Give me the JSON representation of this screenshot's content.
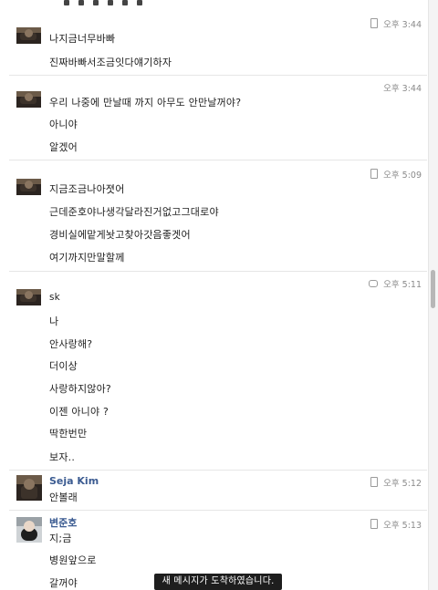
{
  "groups": [
    {
      "time": "오후 3:44",
      "messages": [
        "나지금너무바빠",
        "진짜바빠서조금잇다얘기하자"
      ]
    },
    {
      "time": "오후 3:44",
      "messages": [
        "우리 나중에 만날때 까지 아무도 안만날꺼야?",
        "아니야",
        "알겠어"
      ]
    },
    {
      "time": "오후 5:09",
      "messages": [
        "지금조금나아졋어",
        "근데준호야나생각달라진거없고그대로야",
        "경비실에맡게놧고찾아갓음좋겟어",
        "여기까지만말할께"
      ]
    },
    {
      "time": "오후 5:11",
      "messages": [
        "sk",
        "나",
        "안사랑해?",
        "더이상",
        "사랑하지않아?",
        "이젠 아니야 ?",
        "딱한번만",
        "보자.."
      ]
    },
    {
      "name": "Seja Kim",
      "time": "오후 5:12",
      "messages": [
        "안볼래"
      ]
    },
    {
      "name": "변준호",
      "time": "오후 5:13",
      "messages": [
        "지;금",
        "병원앞으로",
        "갈꺼야"
      ]
    }
  ],
  "toast": "새 메시지가 도착하였습니다.",
  "colors": {
    "name_blue": "#3b5b91",
    "time_gray": "#8a8a8a",
    "toast_bg": "#1e1e1e"
  }
}
